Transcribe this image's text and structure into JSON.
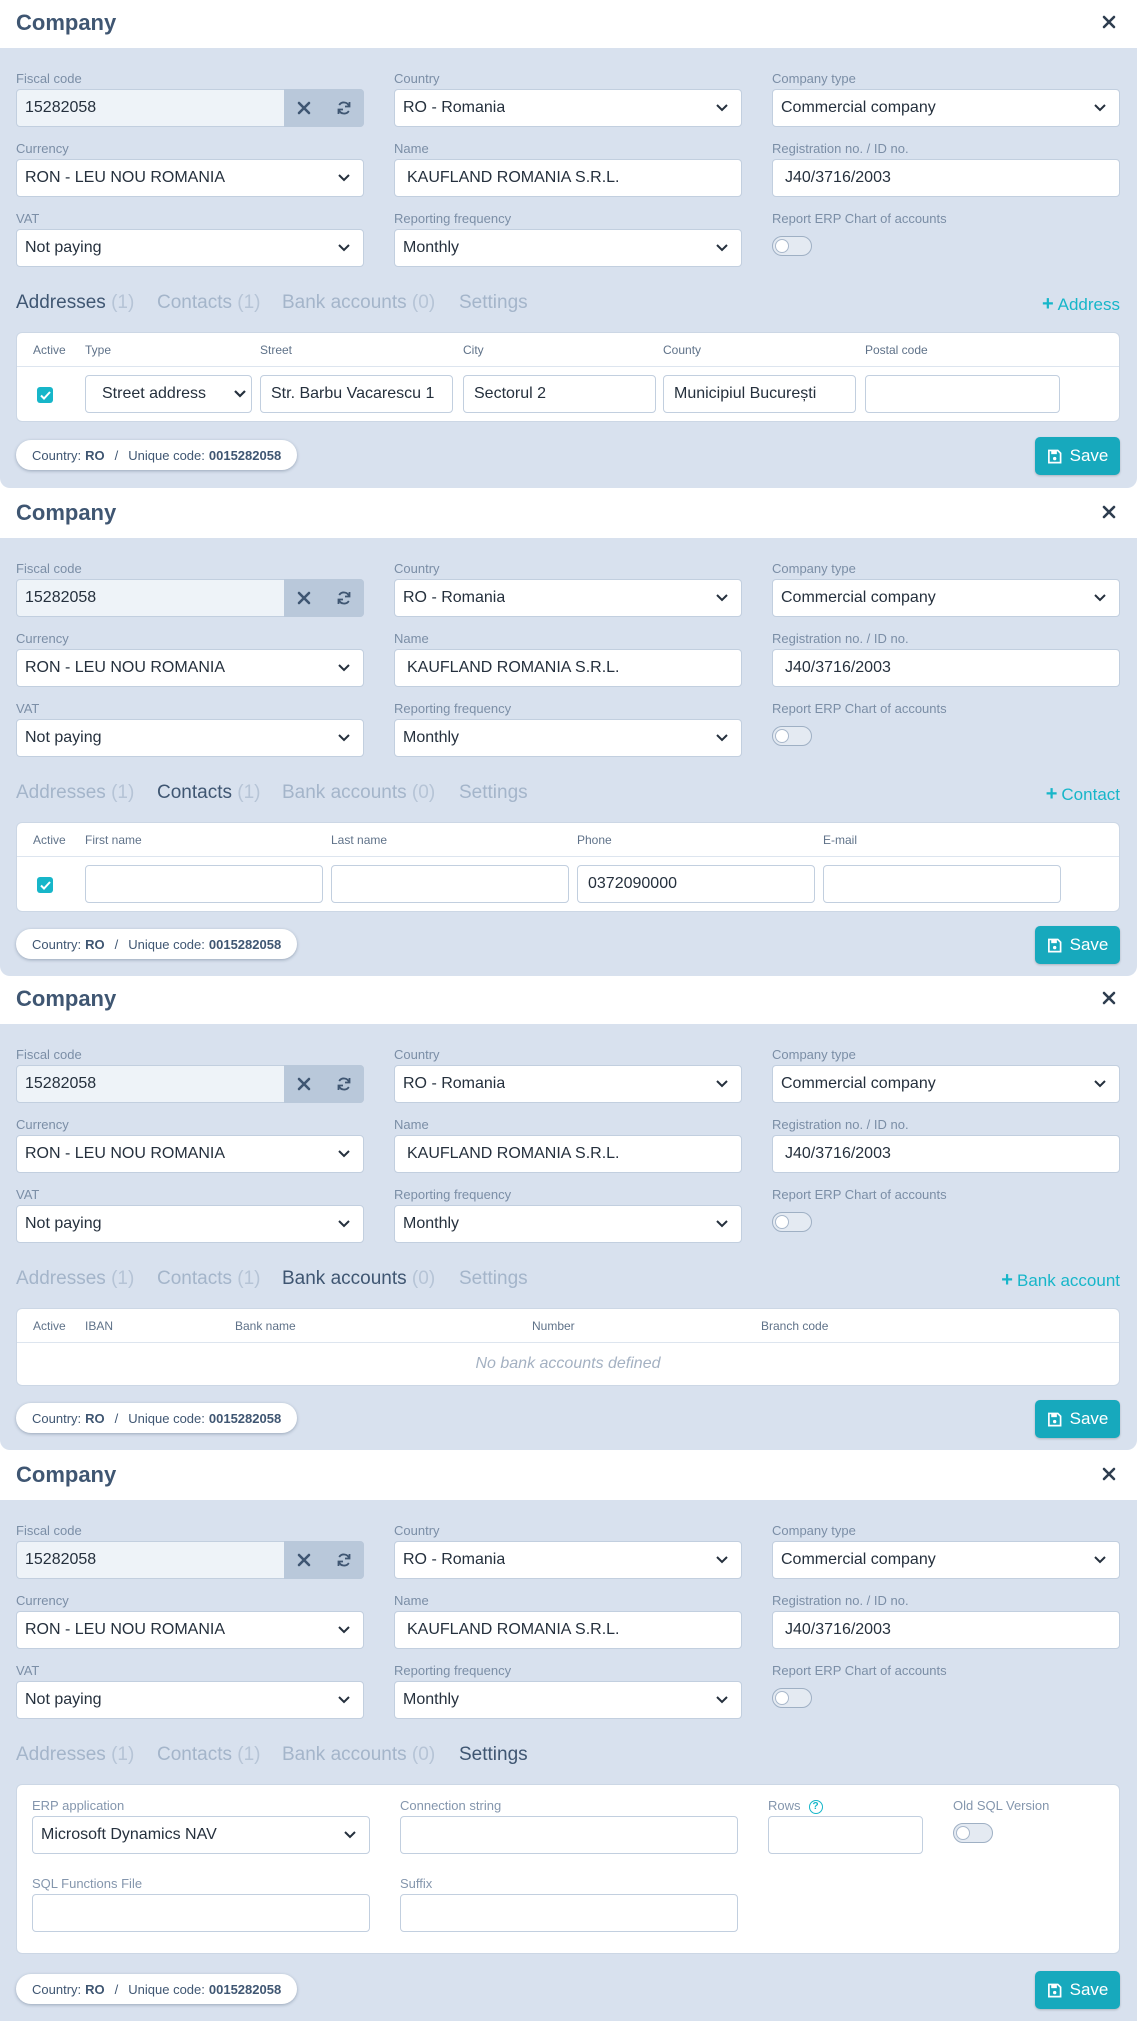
{
  "dialog": {
    "title": "Company",
    "close_icon": "close-icon",
    "fields": {
      "fiscal_code": {
        "label": "Fiscal code",
        "value": "15282058"
      },
      "country": {
        "label": "Country",
        "value": "RO - Romania"
      },
      "company_type": {
        "label": "Company type",
        "value": "Commercial company"
      },
      "currency": {
        "label": "Currency",
        "value": "RON - LEU NOU ROMANIA"
      },
      "name": {
        "label": "Name",
        "value": "KAUFLAND ROMANIA S.R.L."
      },
      "registration": {
        "label": "Registration no. / ID no.",
        "value": "J40/3716/2003"
      },
      "vat": {
        "label": "VAT",
        "value": "Not paying"
      },
      "reporting": {
        "label": "Reporting frequency",
        "value": "Monthly"
      },
      "report_erp": {
        "label": "Report ERP Chart of accounts",
        "enabled": false
      }
    },
    "tabs": {
      "addresses": {
        "label": "Addresses",
        "count": "(1)"
      },
      "contacts": {
        "label": "Contacts",
        "count": "(1)"
      },
      "bank_accounts": {
        "label": "Bank accounts",
        "count": "(0)"
      },
      "settings": {
        "label": "Settings"
      }
    },
    "footer": {
      "country_label": "Country:",
      "country_value": "RO",
      "separator": "/",
      "unique_label": "Unique code:",
      "unique_value": "0015282058"
    },
    "save_label": "Save"
  },
  "addresses": {
    "add_label": "Address",
    "columns": [
      "Active",
      "Type",
      "Street",
      "City",
      "County",
      "Postal code"
    ],
    "row": {
      "active": true,
      "type": "Street address",
      "street": "Str. Barbu Vacarescu 1",
      "city": "Sectorul 2",
      "county": "Municipiul București",
      "postal_code": ""
    }
  },
  "contacts": {
    "add_label": "Contact",
    "columns": [
      "Active",
      "First name",
      "Last name",
      "Phone",
      "E-mail"
    ],
    "row": {
      "active": true,
      "first_name": "",
      "last_name": "",
      "phone": "0372090000",
      "email": ""
    }
  },
  "bank_accounts": {
    "add_label": "Bank account",
    "columns": [
      "Active",
      "IBAN",
      "Bank name",
      "Number",
      "Branch code"
    ],
    "empty_text": "No bank accounts defined"
  },
  "settings": {
    "erp_application": {
      "label": "ERP application",
      "value": "Microsoft Dynamics NAV"
    },
    "connection_string": {
      "label": "Connection string",
      "value": ""
    },
    "rows": {
      "label": "Rows",
      "value": ""
    },
    "old_sql": {
      "label": "Old SQL Version",
      "enabled": false
    },
    "sql_functions": {
      "label": "SQL Functions File",
      "value": ""
    },
    "suffix": {
      "label": "Suffix",
      "value": ""
    }
  },
  "colors": {
    "accent": "#17b6c9",
    "panel_bg": "#d8e1ee",
    "title": "#3f5672"
  }
}
